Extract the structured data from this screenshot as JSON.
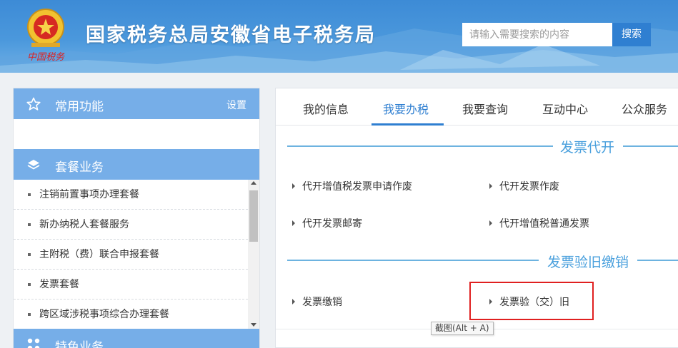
{
  "header": {
    "site_title": "国家税务总局安徽省电子税务局",
    "emblem_caption": "中国税务",
    "search_placeholder": "请输入需要搜索的内容",
    "search_button": "搜索",
    "primary_color": "#4a96db"
  },
  "sidebar": {
    "common": {
      "title": "常用功能",
      "settings": "设置",
      "icon": "star-icon"
    },
    "packages": {
      "title": "套餐业务",
      "icon": "layers-icon",
      "items": [
        "注销前置事项办理套餐",
        "新办纳税人套餐服务",
        "主附税（费）联合申报套餐",
        "发票套餐",
        "跨区域涉税事项综合办理套餐"
      ]
    },
    "special": {
      "title": "特色业务",
      "icon": "grid-icon"
    }
  },
  "main": {
    "tabs": [
      "我的信息",
      "我要办税",
      "我要查询",
      "互动中心",
      "公众服务"
    ],
    "active_tab": "我要办税",
    "sections": [
      {
        "title": "发票代开",
        "links": [
          "代开增值税发票申请作废",
          "代开发票作废",
          "代开发票邮寄",
          "代开增值税普通发票"
        ]
      },
      {
        "title": "发票验旧缴销",
        "links": [
          "发票缴销",
          "发票验（交）旧"
        ]
      }
    ]
  },
  "tooltip": "截图(Alt + A)",
  "colors": {
    "accent": "#2f7fd1",
    "section_head": "#76aee8",
    "highlight_box": "#e02020",
    "section_title": "#4aa0dd"
  }
}
